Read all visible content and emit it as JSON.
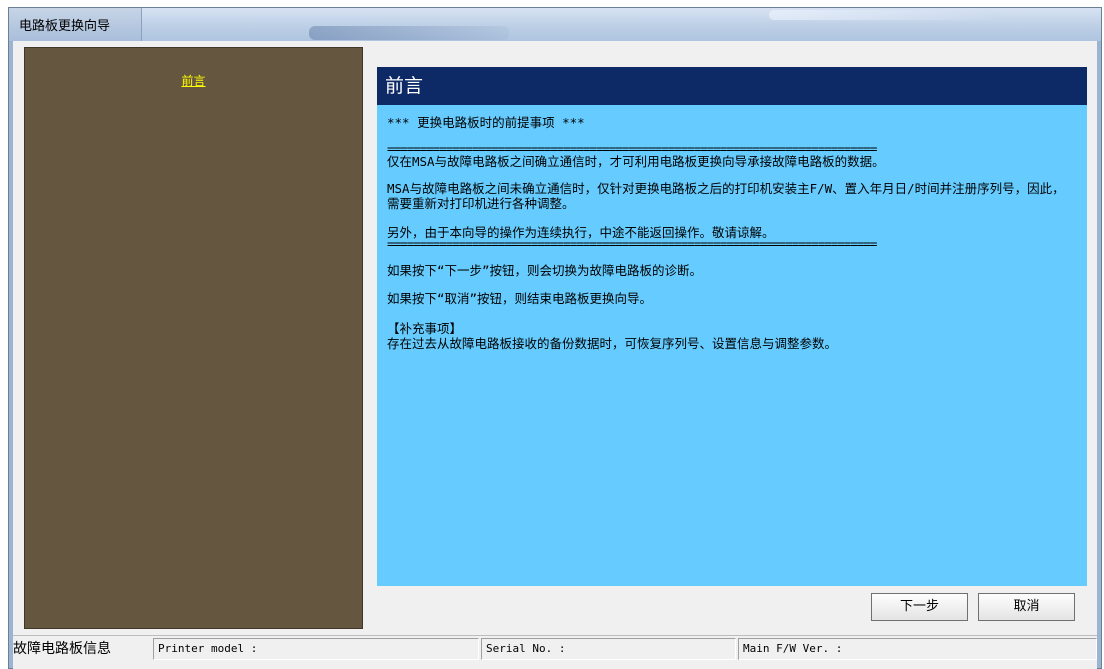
{
  "window": {
    "title": "电路板更换向导"
  },
  "sidebar": {
    "current_step": "前言"
  },
  "main": {
    "header": "前言",
    "content": {
      "heading": "*** 更换电路板时的前提事项 ***",
      "separator": "===========================================================================",
      "p1": "仅在MSA与故障电路板之间确立通信时，才可利用电路板更换向导承接故障电路板的数据。",
      "p2": "MSA与故障电路板之间未确立通信时，仅针对更换电路板之后的打印机安装主F/W、置入年月日/时间并注册序列号，因此，需要重新对打印机进行各种调整。",
      "p3": "另外，由于本向导的操作为连续执行，中途不能返回操作。敬请谅解。",
      "p4": "如果按下“下一步”按钮，则会切换为故障电路板的诊断。",
      "p5": "如果按下“取消”按钮，则结束电路板更换向导。",
      "supplement_title": "【补充事项】",
      "supplement_text": "存在过去从故障电路板接收的备份数据时，可恢复序列号、设置信息与调整参数。"
    }
  },
  "buttons": {
    "next": "下一步",
    "cancel": "取消"
  },
  "statusbar": {
    "label": "故障电路板信息",
    "printer_model": "Printer model :",
    "serial_no": "Serial No. :",
    "main_fw": "Main F/W Ver. :"
  },
  "colors": {
    "sidebar_bg": "#65563f",
    "step_text": "#ffff00",
    "header_bg": "#0d2a66",
    "content_bg": "#66ccff"
  }
}
